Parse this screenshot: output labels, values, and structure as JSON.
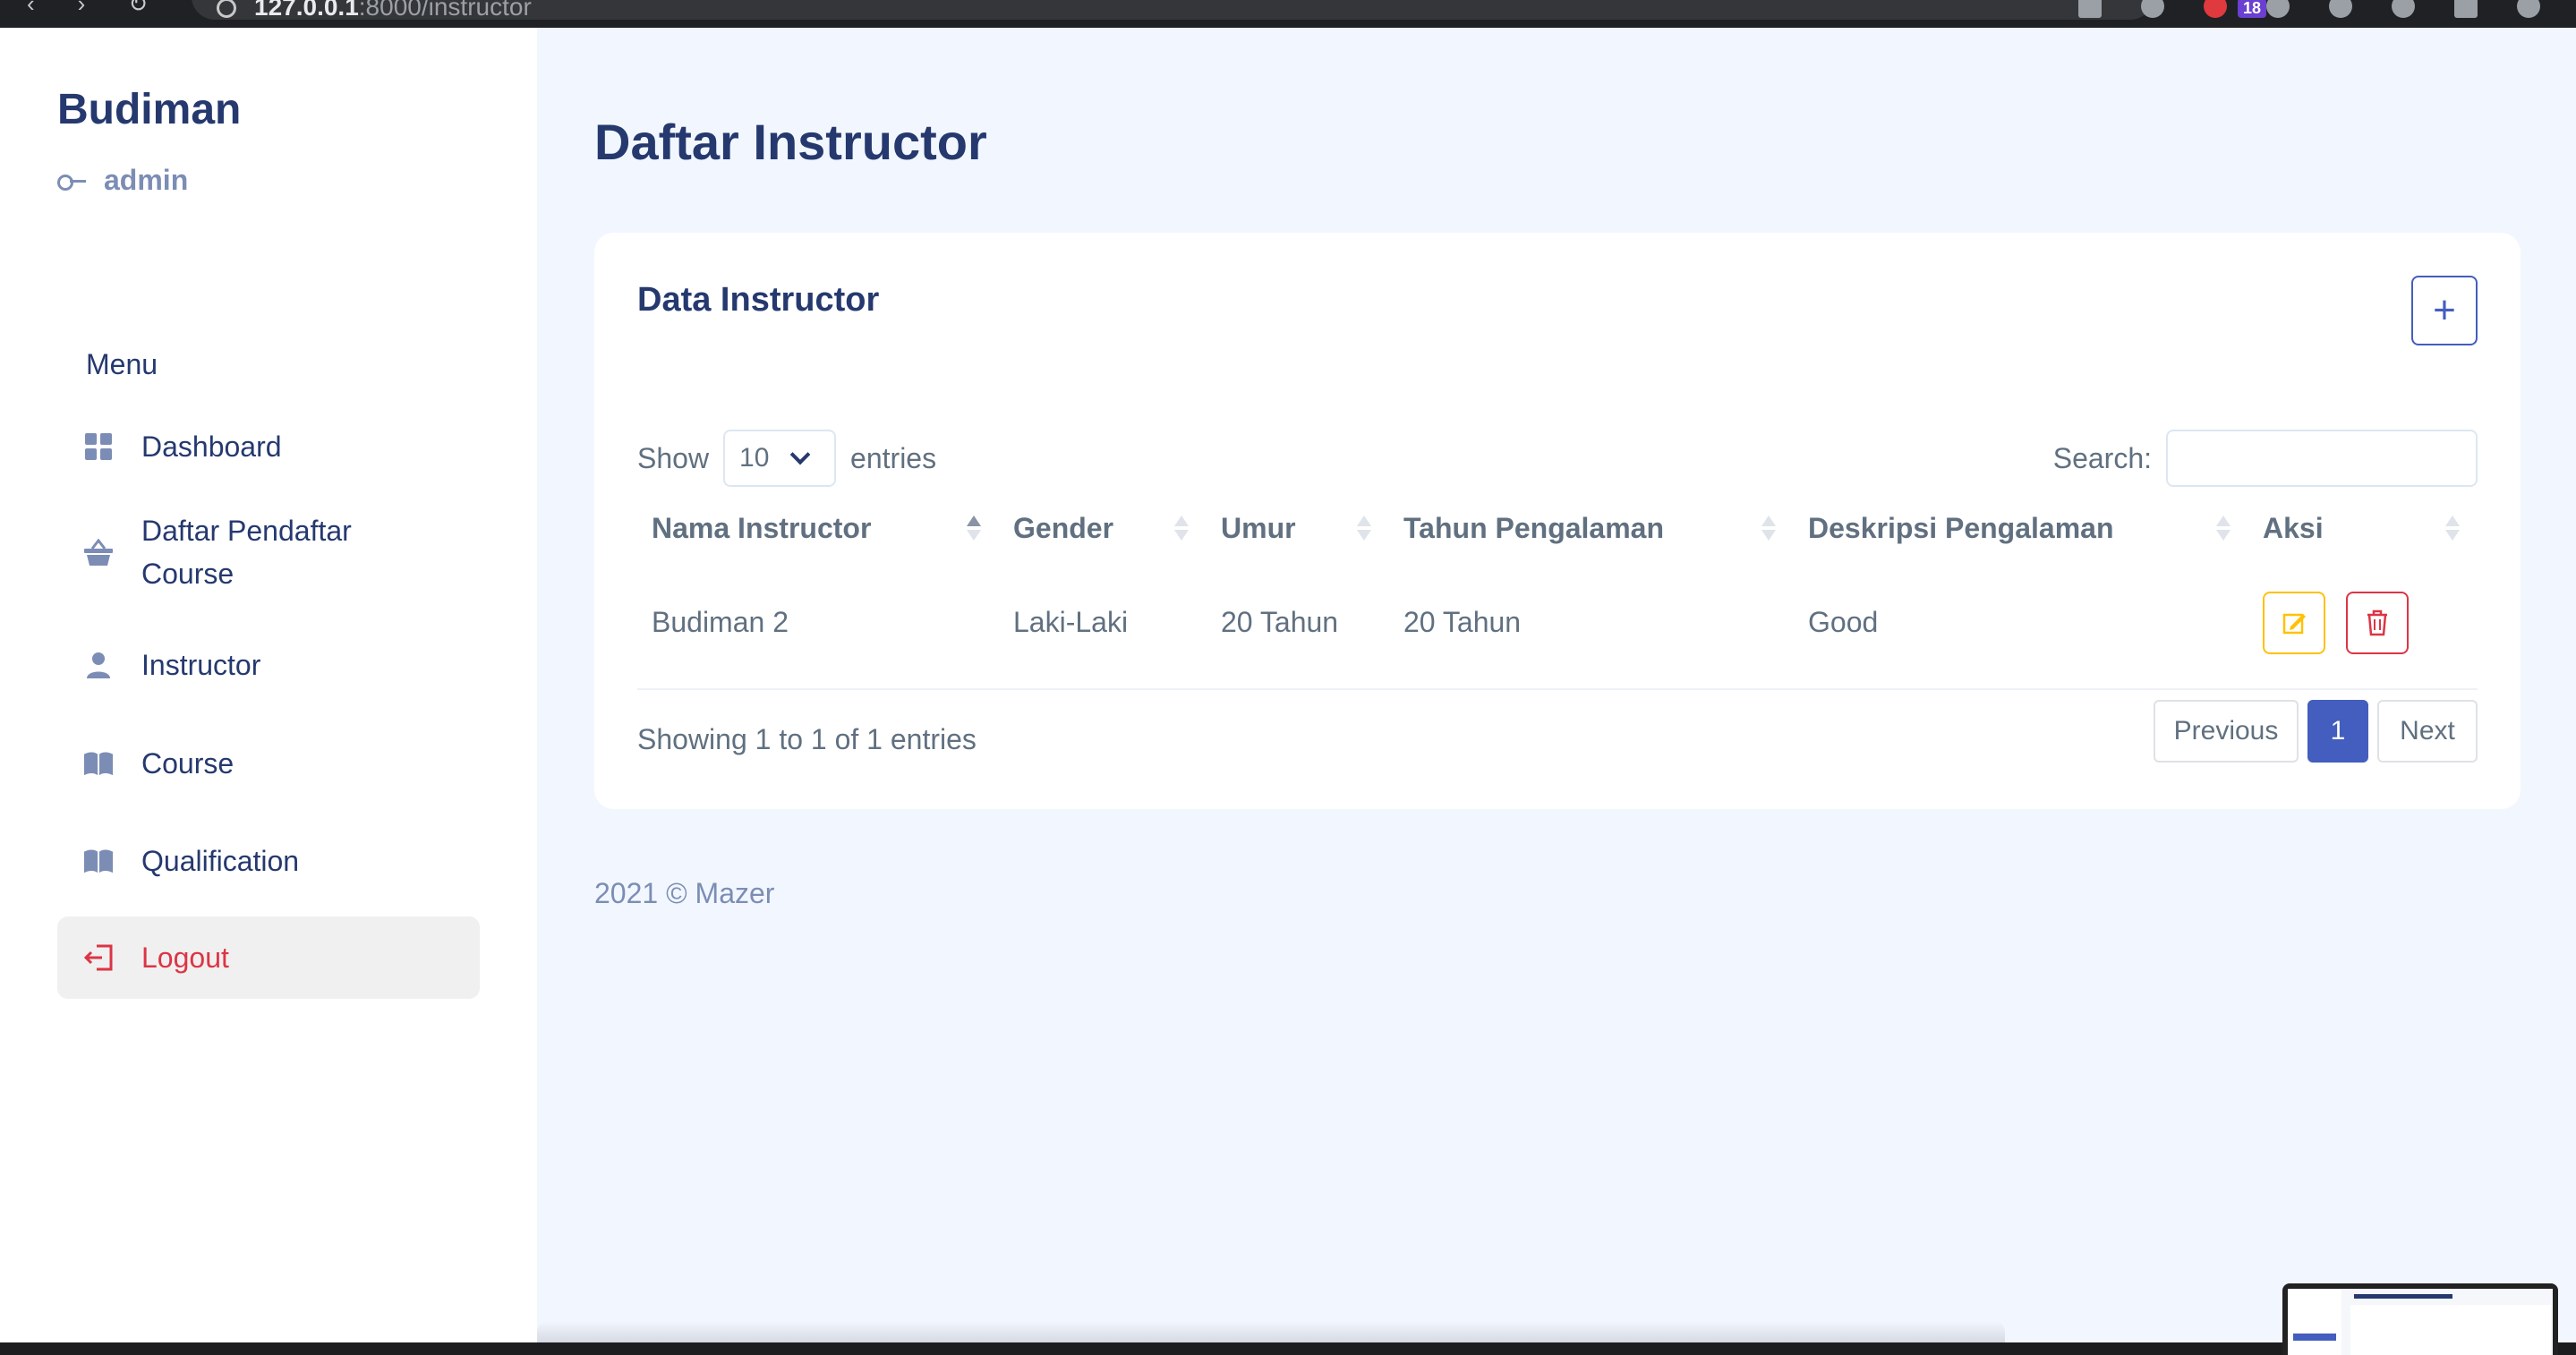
{
  "browser": {
    "url_host": "127.0.0.1",
    "url_path": ":8000/instructor",
    "extension_badge": "18"
  },
  "sidebar": {
    "brand": "Budiman",
    "role": "admin",
    "menu_title": "Menu",
    "items": [
      {
        "label": "Dashboard",
        "icon": "grid-icon"
      },
      {
        "label": "Daftar Pendaftar Course",
        "icon": "basket-icon"
      },
      {
        "label": "Instructor",
        "icon": "person-icon"
      },
      {
        "label": "Course",
        "icon": "book-icon"
      },
      {
        "label": "Qualification",
        "icon": "book-icon"
      },
      {
        "label": "Logout",
        "icon": "logout-icon"
      }
    ]
  },
  "main": {
    "page_title": "Daftar Instructor",
    "card_title": "Data Instructor",
    "add_button_label": "+",
    "show_label": "Show",
    "entries_label": "entries",
    "page_length": "10",
    "search_label": "Search:",
    "search_value": "",
    "columns": [
      "Nama Instructor",
      "Gender",
      "Umur",
      "Tahun Pengalaman",
      "Deskripsi Pengalaman",
      "Aksi"
    ],
    "rows": [
      {
        "nama": "Budiman 2",
        "gender": "Laki-Laki",
        "umur": "20 Tahun",
        "tahun": "20 Tahun",
        "deskripsi": "Good"
      }
    ],
    "info": "Showing 1 to 1 of 1 entries",
    "pagination": {
      "previous": "Previous",
      "current": "1",
      "next": "Next"
    },
    "footer": "2021 © Mazer"
  },
  "colors": {
    "primary": "#435ebe",
    "heading": "#25396f",
    "danger": "#dc3545",
    "warning": "#ffc107",
    "body_bg": "#f2f7ff"
  }
}
